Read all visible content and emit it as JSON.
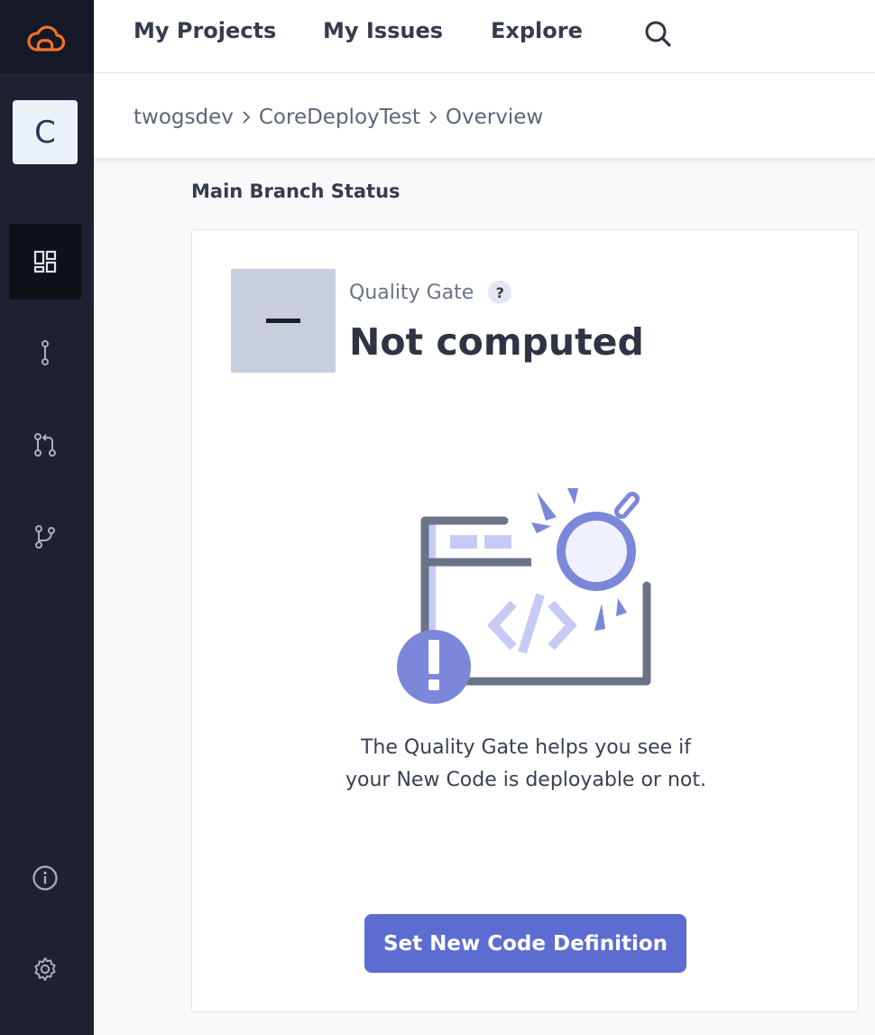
{
  "topbar": {
    "nav": [
      {
        "label": "My Projects"
      },
      {
        "label": "My Issues"
      },
      {
        "label": "Explore"
      }
    ]
  },
  "sidebar": {
    "avatar_letter": "C",
    "items": [
      {
        "icon": "dashboard-icon",
        "active": true
      },
      {
        "icon": "branch-line-icon",
        "active": false
      },
      {
        "icon": "pull-request-icon",
        "active": false
      },
      {
        "icon": "git-branch-icon",
        "active": false
      },
      {
        "icon": "info-icon",
        "active": false
      },
      {
        "icon": "gear-icon",
        "active": false
      }
    ]
  },
  "breadcrumb": {
    "org": "twogsdev",
    "project": "CoreDeployTest",
    "page": "Overview"
  },
  "main": {
    "section_title": "Main Branch Status",
    "quality_gate": {
      "label": "Quality Gate",
      "help": "?",
      "status": "Not computed",
      "badge": "–"
    },
    "description": "The Quality Gate helps you see if your New Code is deployable or not.",
    "cta_label": "Set New Code Definition"
  },
  "colors": {
    "sidebar": "#1e2132",
    "accent": "#5d6cd0",
    "logo": "#f2712b",
    "gate_box": "#c9cedf"
  }
}
